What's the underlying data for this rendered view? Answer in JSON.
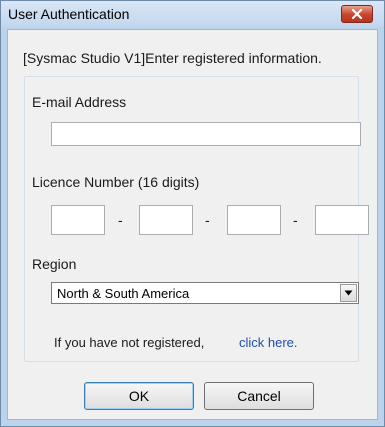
{
  "window": {
    "title": "User Authentication",
    "close_glyph": "✕"
  },
  "dialog": {
    "instruction": "[Sysmac Studio V1]Enter registered information.",
    "email": {
      "label": "E-mail Address",
      "value": ""
    },
    "licence": {
      "label": "Licence Number (16 digits)",
      "separator": "-",
      "segments": [
        "",
        "",
        "",
        ""
      ]
    },
    "region": {
      "label": "Region",
      "selected": "North & South America"
    },
    "register_note": "If you have not registered,",
    "register_link": "click here.",
    "buttons": {
      "ok": "OK",
      "cancel": "Cancel"
    }
  },
  "icons": {
    "close": "close-icon",
    "dropdown": "chevron-down-icon"
  },
  "colors": {
    "title_bar": "#c9dcf1",
    "close_button": "#c7432b",
    "link": "#1f4fa8"
  }
}
